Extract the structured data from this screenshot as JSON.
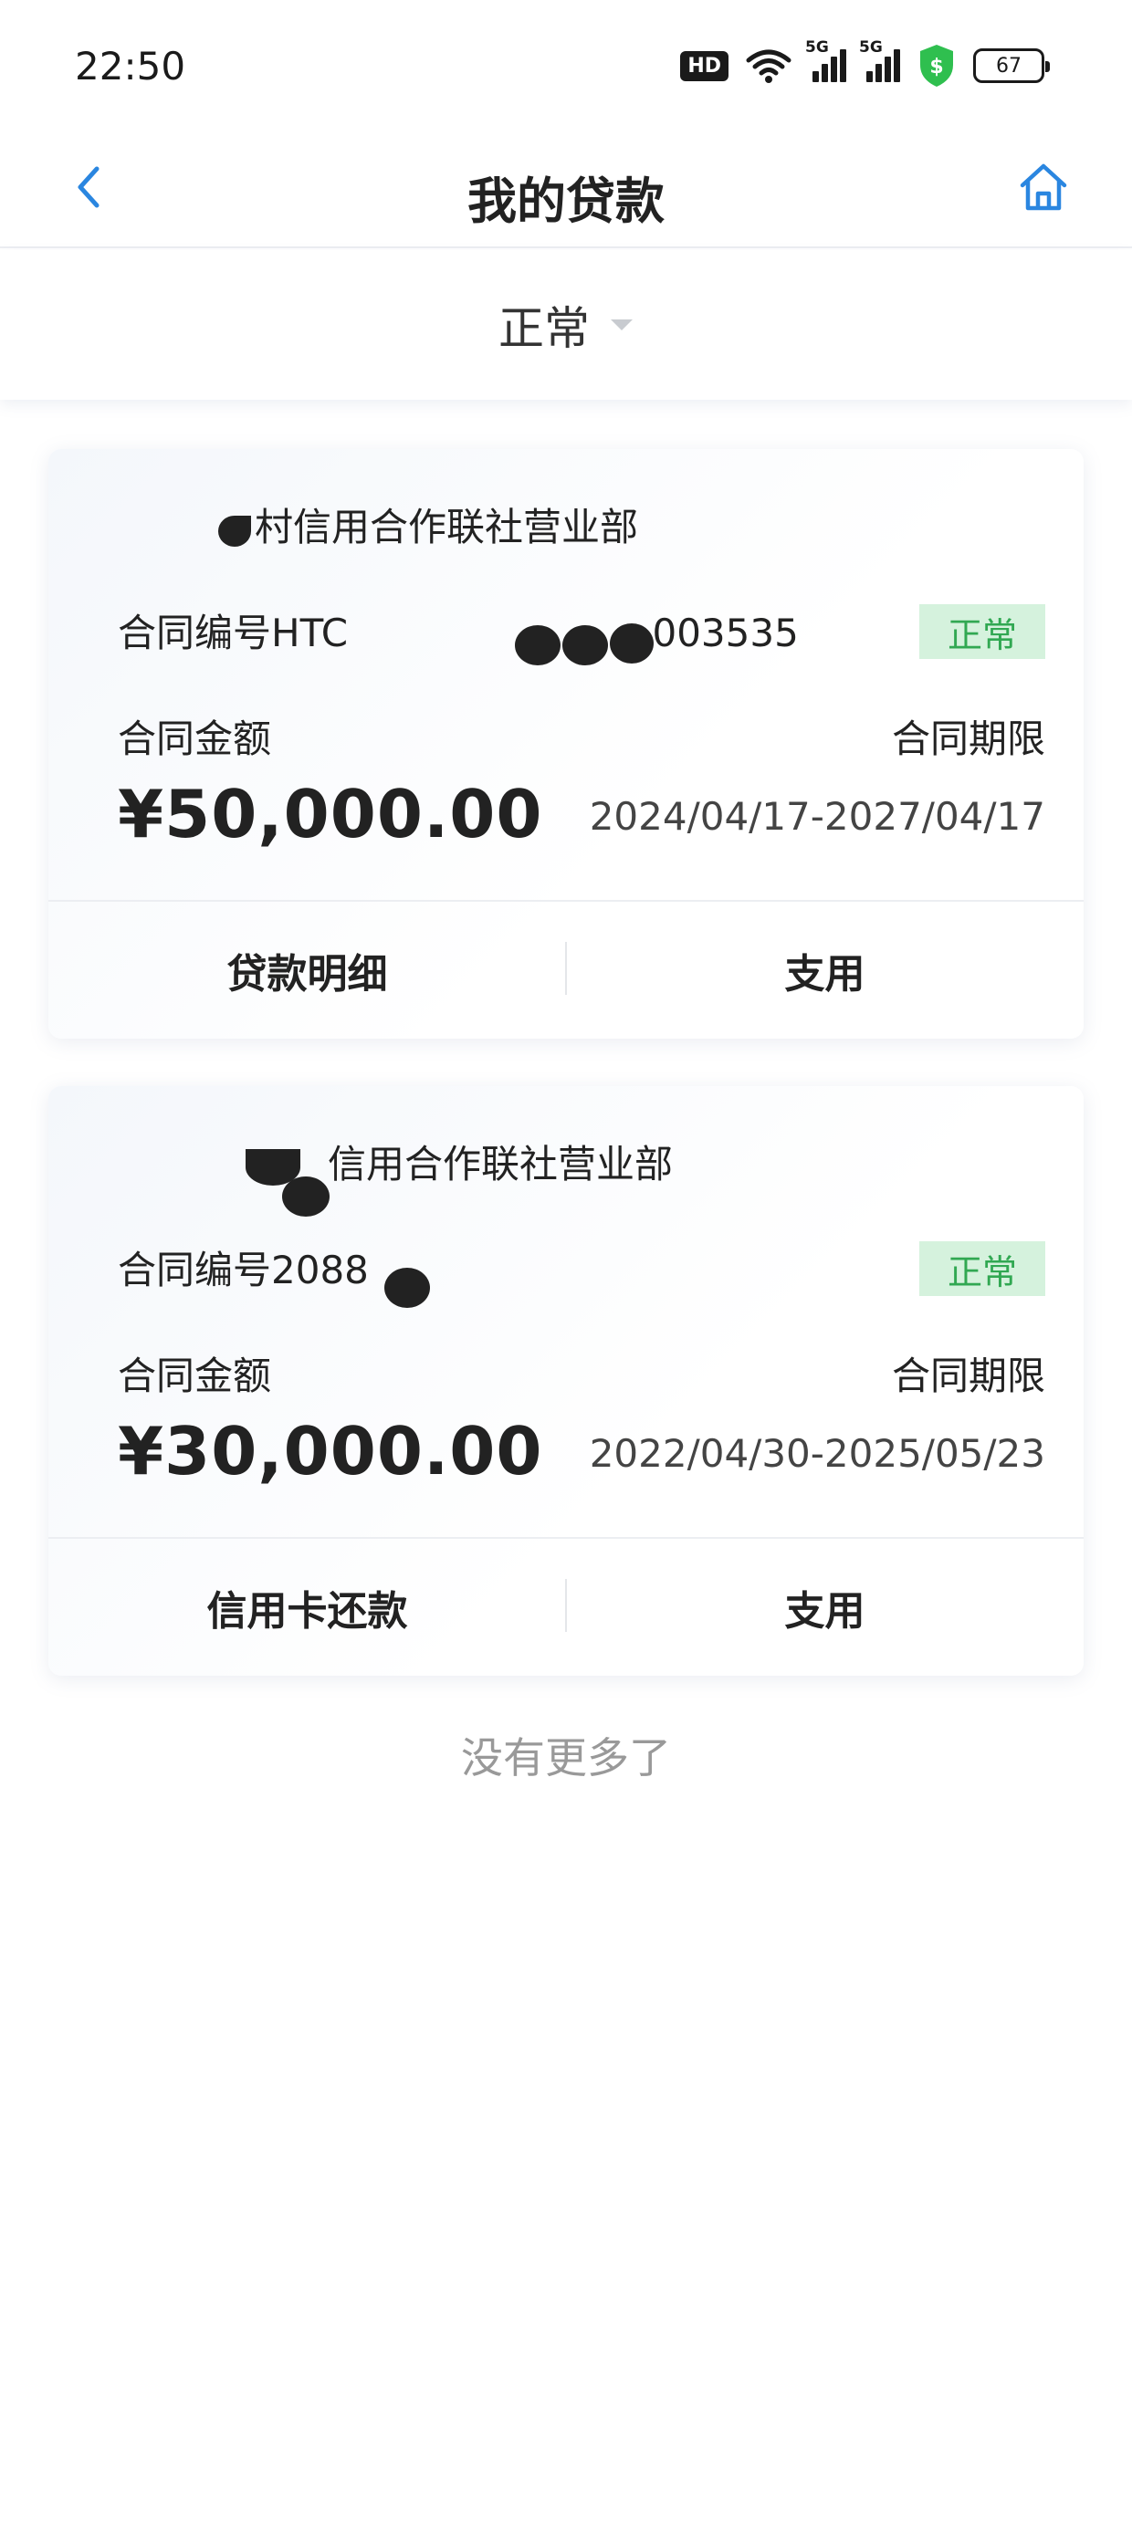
{
  "status_bar": {
    "time": "22:50",
    "hd_label": "HD",
    "signal_label_1": "5G",
    "signal_label_2": "5G",
    "battery_level": "67"
  },
  "header": {
    "title": "我的贷款"
  },
  "filter": {
    "selected": "正常"
  },
  "loans": [
    {
      "bank": "村信用合作联社营业部",
      "contract_prefix": "合同编号HTC",
      "contract_suffix": "003535",
      "status": "正常",
      "amount_label": "合同金额",
      "amount": "¥50,000.00",
      "term_label": "合同期限",
      "term": "2024/04/17-2027/04/17",
      "action_left": "贷款明细",
      "action_right": "支用"
    },
    {
      "bank": "信用合作联社营业部",
      "contract_prefix": "合同编号2088",
      "contract_suffix": "",
      "status": "正常",
      "amount_label": "合同金额",
      "amount": "¥30,000.00",
      "term_label": "合同期限",
      "term": "2022/04/30-2025/05/23",
      "action_left": "信用卡还款",
      "action_right": "支用"
    }
  ],
  "footer": {
    "no_more": "没有更多了"
  },
  "colors": {
    "accent_blue": "#2a86e0",
    "status_green": "#31a852",
    "status_green_bg": "#d5f2dd",
    "shield_green": "#2fbf4f"
  }
}
